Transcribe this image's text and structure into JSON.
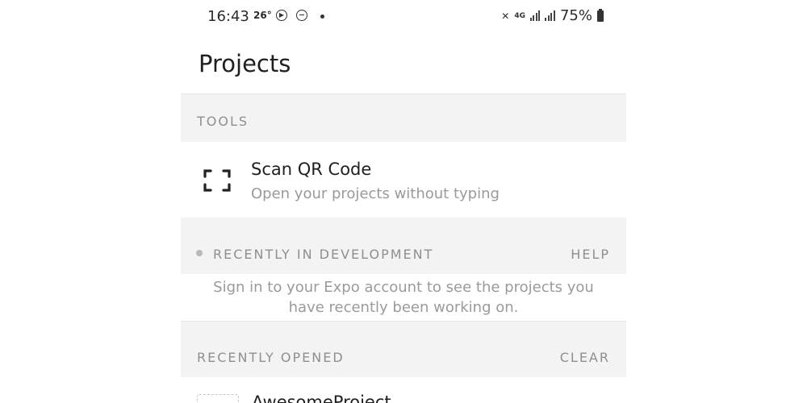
{
  "status_bar": {
    "time": "16:43",
    "temperature": "26°",
    "battery": "75%",
    "network": "4G"
  },
  "header": {
    "title": "Projects"
  },
  "tools": {
    "section_label": "TOOLS",
    "scan_title": "Scan QR Code",
    "scan_subtitle": "Open your projects without typing"
  },
  "recent_dev": {
    "section_label": "RECENTLY IN DEVELOPMENT",
    "action": "HELP",
    "message_line1": "Sign in to your Expo account to see the projects you",
    "message_line2": "have recently been working on."
  },
  "recent_opened": {
    "section_label": "RECENTLY OPENED",
    "action": "CLEAR",
    "items": [
      {
        "name": "AwesomeProject"
      }
    ]
  },
  "icons": {
    "qr": "scan-qr-icon",
    "play": "play-circle-icon",
    "dnd": "do-not-disturb-icon",
    "mute": "vibrate-mute-icon",
    "signal": "signal-icon",
    "battery": "battery-icon"
  }
}
